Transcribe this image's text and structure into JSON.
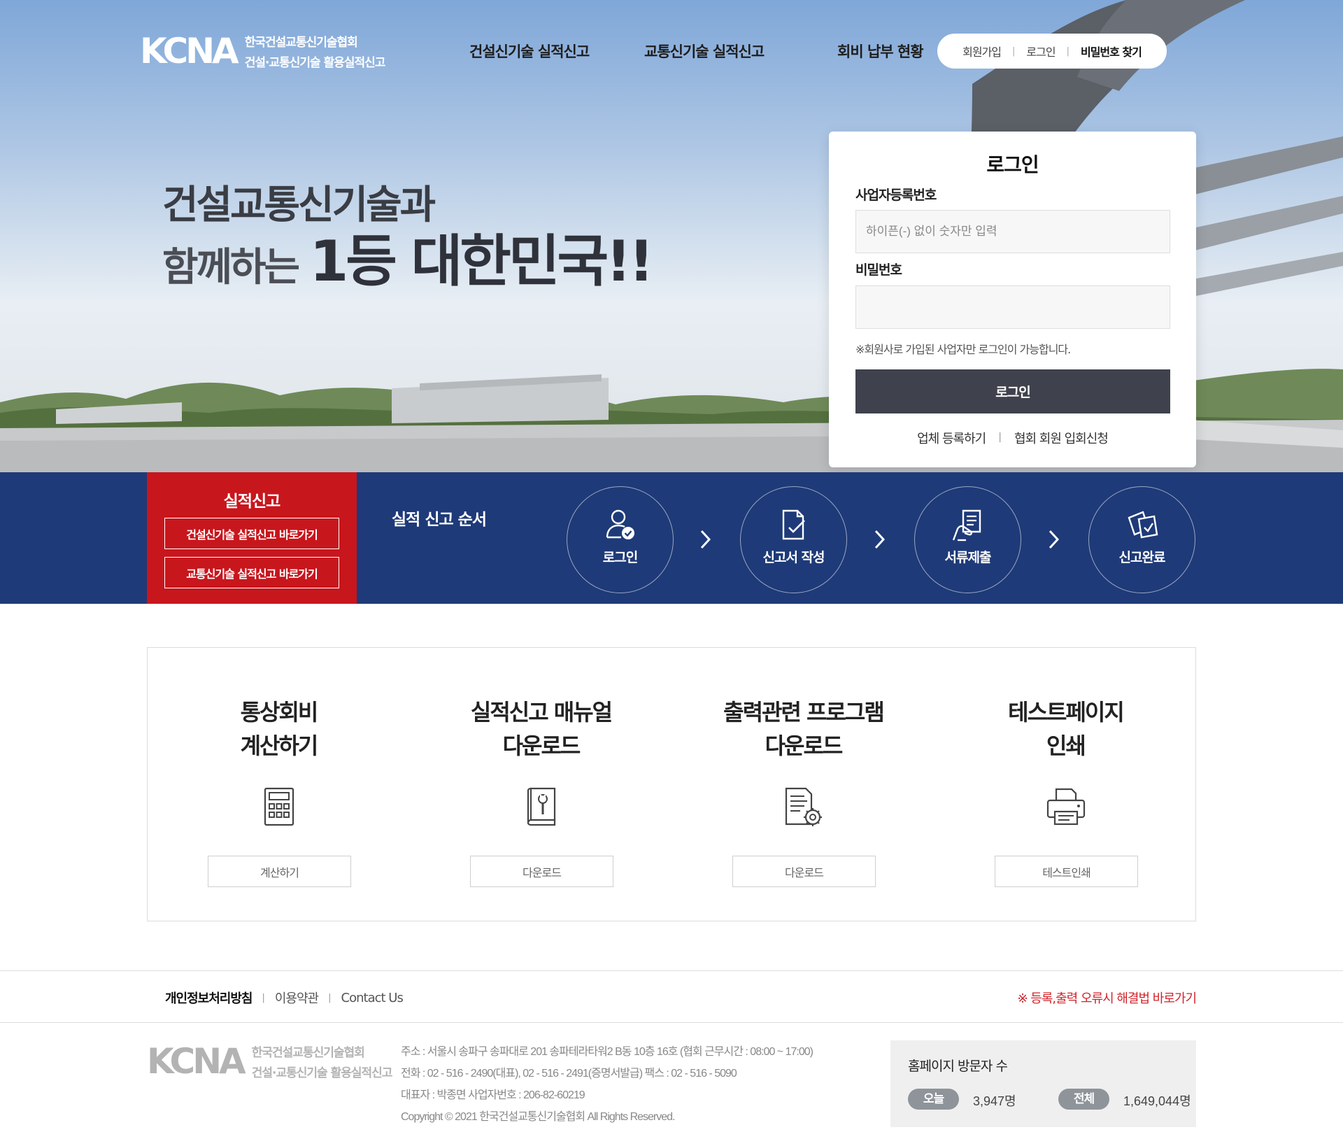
{
  "header": {
    "logo_mark": "KCNA",
    "logo_line1": "한국건설교통신기술협회",
    "logo_line2": "건설·교통신기술 활용실적신고",
    "nav": [
      {
        "label": "건설신기술 실적신고"
      },
      {
        "label": "교통신기술 실적신고"
      },
      {
        "label": "회비 납부 현황"
      }
    ],
    "util": {
      "join": "회원가입",
      "login": "로그인",
      "find_password": "비밀번호 찾기"
    }
  },
  "hero": {
    "line1": "건설교통신기술과",
    "line2_prefix": "함께하는 ",
    "line2_big": "1등 대한민국!!"
  },
  "login": {
    "title": "로그인",
    "business_label": "사업자등록번호",
    "business_placeholder": "하이픈(-) 없이 숫자만 입력",
    "password_label": "비밀번호",
    "password_value": "",
    "note": "※회원사로 가입된 사업자만 로그인이 가능합니다.",
    "submit": "로그인",
    "link_register": "업체 등록하기",
    "link_apply": "협회 회원 입회신청"
  },
  "report": {
    "title": "실적신고",
    "btn_construction": "건설신기술 실적신고 바로가기",
    "btn_traffic": "교통신기술 실적신고 바로가기",
    "order_title": "실적 신고 순서",
    "steps": [
      {
        "label": "로그인",
        "icon": "user-check-icon"
      },
      {
        "label": "신고서 작성",
        "icon": "document-edit-icon"
      },
      {
        "label": "서류제출",
        "icon": "hand-document-icon"
      },
      {
        "label": "신고완료",
        "icon": "documents-complete-icon"
      }
    ]
  },
  "downloads": [
    {
      "title_line1": "통상회비",
      "title_line2": "계산하기",
      "button": "계산하기",
      "icon": "calculator-icon"
    },
    {
      "title_line1": "실적신고 매뉴얼",
      "title_line2": "다운로드",
      "button": "다운로드",
      "icon": "manual-book-icon"
    },
    {
      "title_line1": "출력관련 프로그램",
      "title_line2": "다운로드",
      "button": "다운로드",
      "icon": "program-settings-icon"
    },
    {
      "title_line1": "테스트페이지",
      "title_line2": "인쇄",
      "button": "테스트인쇄",
      "icon": "printer-icon"
    }
  ],
  "footer": {
    "privacy": "개인정보처리방침",
    "terms": "이용약관",
    "contact": "Contact Us",
    "error_link": "※ 등록,출력 오류시 해결법 바로가기",
    "logo_mark": "KCNA",
    "logo_line1": "한국건설교통신기술협회",
    "logo_line2": "건설·교통신기술 활용실적신고",
    "address": "주소 : 서울시 송파구 송파대로 201 송파테라타워2 B동 10층 16호 (협회 근무시간 : 08:00 ~ 17:00)",
    "phone": "전화 : 02 - 516 - 2490(대표), 02 - 516 - 2491(증명서발급) 팩스 : 02 - 516 - 5090",
    "ceo": "대표자 : 박종면 사업자번호 : 206-82-60219",
    "copyright": "Copyright © 2021 한국건설교통신기술협회 All Rights Reserved.",
    "visitors_title": "홈페이지 방문자 수",
    "today_label": "오늘",
    "today_value": "3,947명",
    "total_label": "전체",
    "total_value": "1,649,044명"
  },
  "colors": {
    "band_blue": "#1e3a78",
    "report_red": "#c8161d",
    "login_button": "#3f424d",
    "error_red": "#d2232a"
  }
}
